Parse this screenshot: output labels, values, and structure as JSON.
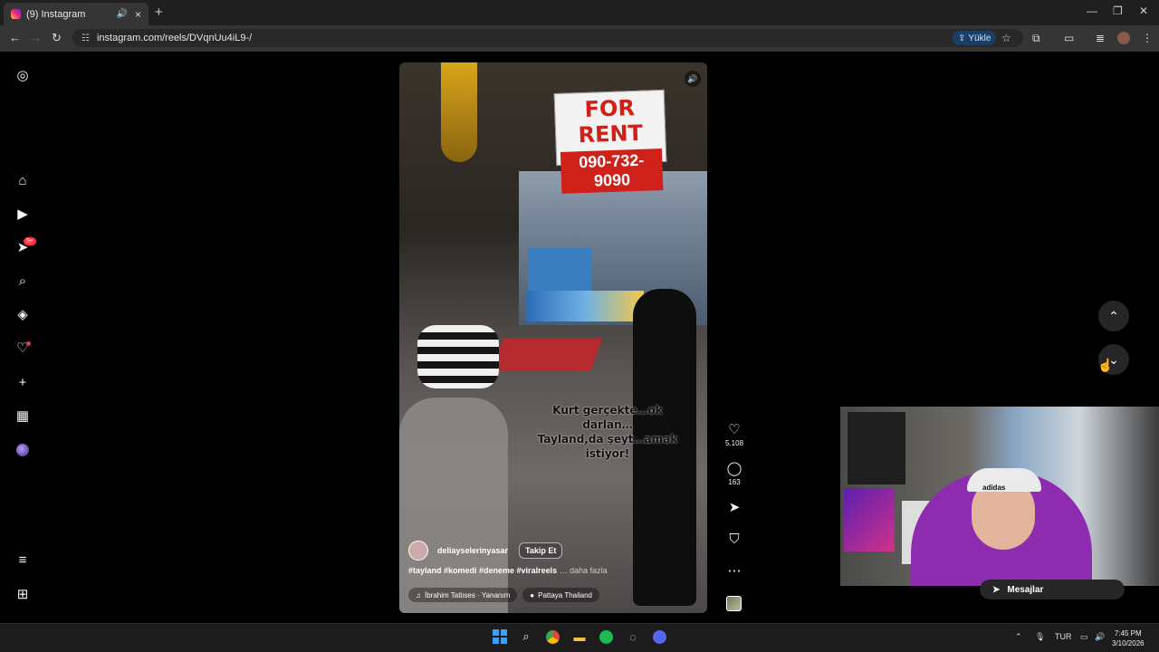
{
  "browser": {
    "tab_title": "(9) Instagram",
    "new_tab": "+",
    "url": "instagram.com/reels/DVqnUu4iL9-/",
    "upload_label": "Yükle",
    "window_controls": {
      "minimize": "—",
      "restore": "❐",
      "close": "✕"
    }
  },
  "sidebar": {
    "notification_badge": "9+",
    "items": [
      {
        "name": "instagram-logo-icon",
        "glyph": "◎"
      },
      {
        "name": "home-icon",
        "glyph": "⌂"
      },
      {
        "name": "reels-icon",
        "glyph": "▶"
      },
      {
        "name": "messages-icon",
        "glyph": "➤"
      },
      {
        "name": "search-icon",
        "glyph": "⌕"
      },
      {
        "name": "explore-icon",
        "glyph": "◈"
      },
      {
        "name": "notifications-icon",
        "glyph": "♡"
      },
      {
        "name": "create-icon",
        "glyph": "+"
      },
      {
        "name": "dashboard-icon",
        "glyph": "▦"
      },
      {
        "name": "more-icon",
        "glyph": "≡"
      },
      {
        "name": "also-from-meta-icon",
        "glyph": "⊞"
      }
    ]
  },
  "reel": {
    "sign_line1": "FOR RENT",
    "sign_line2": "090-732-9090",
    "overlay_caption_line1": "Kurt gerçekte…ok",
    "overlay_caption_line2": "darlan…",
    "overlay_caption_line3": "Tayland,da şeyt…amak",
    "overlay_caption_line4": "istiyor!",
    "username": "deliayselerinyasar",
    "follow_label": "Takip Et",
    "hashtags": "#tayland #komedi #deneme #viralreels",
    "more_label": "… daha fazla",
    "audio": "İbrahim Tatlıses · Yananım",
    "location": "Pattaya Thailand"
  },
  "actions": {
    "likes": "5.108",
    "comments": "163"
  },
  "overlay": {
    "messages_label": "Mesajlar",
    "cap_brand": "adidas"
  },
  "taskbar": {
    "language": "TUR",
    "time": "7:45 PM",
    "date": "3/10/2026"
  }
}
